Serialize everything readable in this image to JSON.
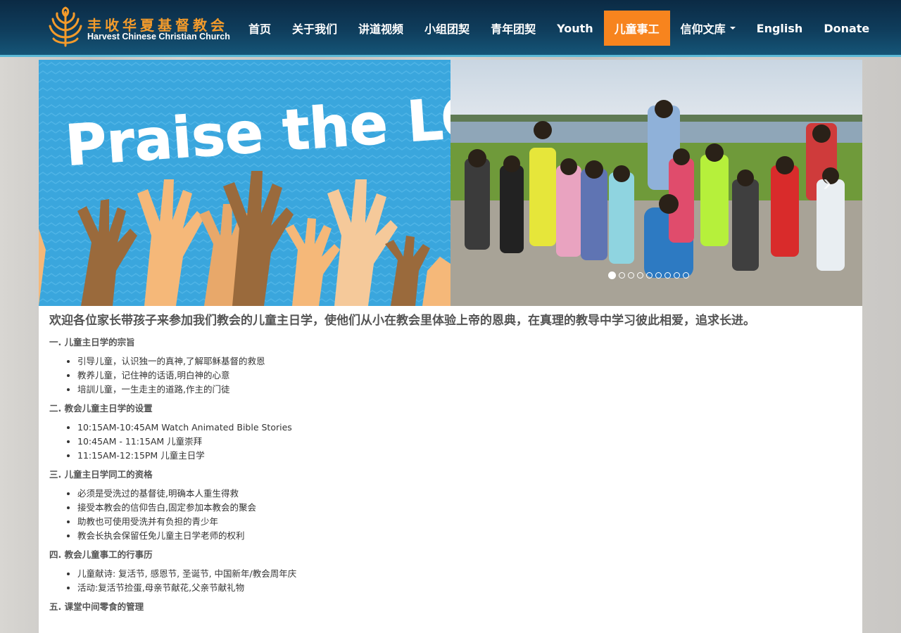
{
  "header": {
    "logo_zh": "丰收华夏基督教会",
    "logo_en": "Harvest Chinese Christian Church",
    "nav": [
      {
        "label": "首页"
      },
      {
        "label": "关于我们"
      },
      {
        "label": "讲道视频"
      },
      {
        "label": "小组团契"
      },
      {
        "label": "青年团契"
      },
      {
        "label": "Youth"
      },
      {
        "label": "儿童事工",
        "active": true
      },
      {
        "label": "信仰文库",
        "dropdown": true
      },
      {
        "label": "English"
      },
      {
        "label": "Donate"
      }
    ],
    "colors": {
      "bar": "#0f3d5c",
      "active": "#f7841e",
      "logo": "#f49b2b"
    }
  },
  "carousel": {
    "slide_count": 9,
    "active_index": 0,
    "next_icon": "chevron-right-icon",
    "slide_text": "Praise the LORD!"
  },
  "content": {
    "intro": "欢迎各位家长带孩子来参加我们教会的儿童主日学，使他们从小在教会里体验上帝的恩典，在真理的教导中学习彼此相爱，追求长进。",
    "sections": [
      {
        "heading": "一. 儿童主日学的宗旨",
        "items": [
          "引导儿童，认识独一的真神,了解耶稣基督的救恩",
          "教养儿童，记住神的话语,明白神的心意",
          "培訓儿童，一生走主的道路,作主的门徒"
        ]
      },
      {
        "heading": "二. 教会儿童主日学的设置",
        "items": [
          "10:15AM-10:45AM Watch Animated Bible Stories",
          "10:45AM - 11:15AM 儿童崇拜",
          "11:15AM-12:15PM 儿童主日学"
        ]
      },
      {
        "heading": "三. 儿童主日学同工的资格",
        "items": [
          "必须是受洗过的基督徒,明确本人重生得救",
          "接受本教会的信仰告白,固定参加本教会的聚会",
          "助教也可使用受洗并有负担的青少年",
          "教会长执会保留任免儿童主日学老师的权利"
        ]
      },
      {
        "heading": "四. 教会儿童事工的行事历",
        "items": [
          "儿童献诗: 复活节, 感恩节, 圣诞节, 中国新年/教会周年庆",
          "活动:复活节捡蛋,母亲节献花,父亲节献礼物"
        ]
      },
      {
        "heading": "五. 课堂中间零食的管理",
        "items": []
      }
    ]
  }
}
